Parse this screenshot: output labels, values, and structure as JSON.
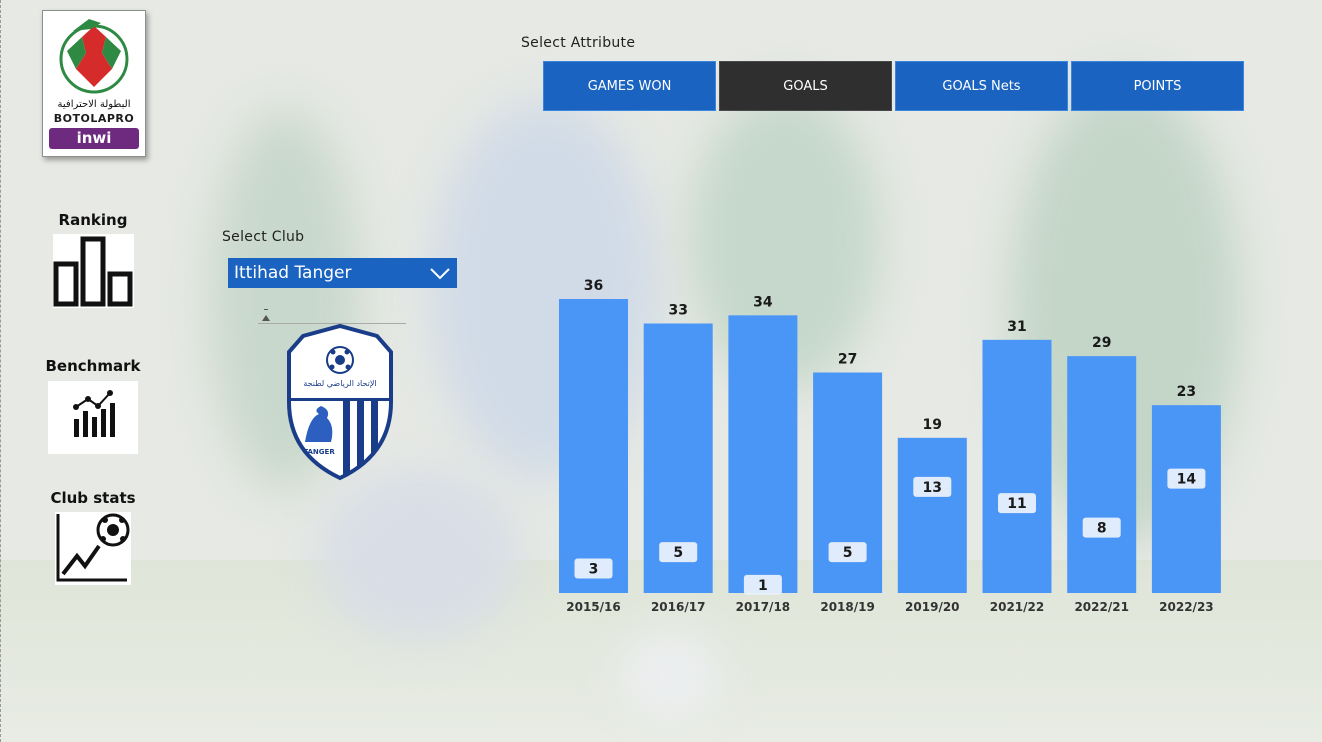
{
  "logo": {
    "arabic_text": "البطولة الاحترافية",
    "brand_text": "BOTOLAPRO",
    "sponsor_text": "inwi"
  },
  "nav": [
    {
      "label": "Ranking",
      "icon": "bar-chart-icon"
    },
    {
      "label": "Benchmark",
      "icon": "trend-bars-icon"
    },
    {
      "label": "Club stats",
      "icon": "football-growth-icon"
    }
  ],
  "attribute_selector": {
    "caption": "Select Attribute",
    "options": [
      "GAMES WON",
      "GOALS",
      "GOALS Nets",
      "POINTS"
    ],
    "selected": "GOALS"
  },
  "club_selector": {
    "caption": "Select Club",
    "value": "Ittihad Tanger"
  },
  "crest": {
    "top_text": "الإتحاد الرياضي لطنجة",
    "bottom_text": "TANGER"
  },
  "colors": {
    "accent": "#1a63c1",
    "active": "#2f2f2f",
    "bar": "#4a96f7",
    "label_bg": "#e8f0fb"
  },
  "chart_data": {
    "type": "bar",
    "categories": [
      "2015/16",
      "2016/17",
      "2017/18",
      "2018/19",
      "2019/20",
      "2021/22",
      "2022/21",
      "2022/23"
    ],
    "series": [
      {
        "values": [
          36,
          33,
          34,
          27,
          19,
          31,
          29,
          23
        ]
      },
      {
        "values": [
          3,
          5,
          1,
          5,
          13,
          11,
          8,
          14
        ]
      }
    ],
    "ylim": [
      0,
      36
    ],
    "grid": false,
    "title": "",
    "xlabel": "",
    "ylabel": ""
  }
}
